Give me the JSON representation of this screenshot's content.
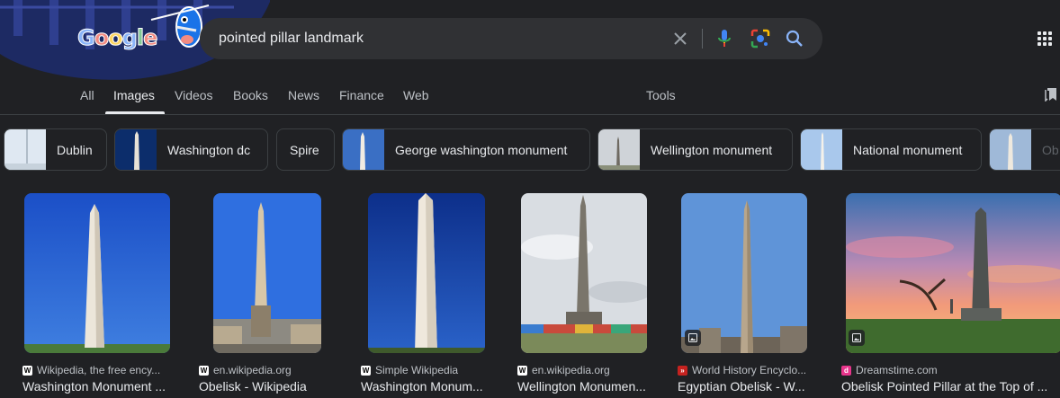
{
  "search": {
    "query": "pointed pillar landmark"
  },
  "logo": {
    "letters": [
      "G",
      "o",
      "o",
      "g",
      "l",
      "e"
    ]
  },
  "tabs": [
    {
      "label": "All"
    },
    {
      "label": "Images"
    },
    {
      "label": "Videos"
    },
    {
      "label": "Books"
    },
    {
      "label": "News"
    },
    {
      "label": "Finance"
    },
    {
      "label": "Web"
    }
  ],
  "tools": {
    "label": "Tools"
  },
  "chips": [
    {
      "label": "Dublin"
    },
    {
      "label": "Washington dc"
    },
    {
      "label": "Spire"
    },
    {
      "label": "George washington monument"
    },
    {
      "label": "Wellington monument"
    },
    {
      "label": "National monument"
    },
    {
      "label": "Ob"
    }
  ],
  "results": [
    {
      "source": "Wikipedia, the free ency...",
      "title": "Washington Monument ...",
      "favicon": "W"
    },
    {
      "source": "en.wikipedia.org",
      "title": "Obelisk - Wikipedia",
      "favicon": "W"
    },
    {
      "source": "Simple Wikipedia",
      "title": "Washington Monum...",
      "favicon": "W"
    },
    {
      "source": "en.wikipedia.org",
      "title": "Wellington Monumen...",
      "favicon": "W"
    },
    {
      "source": "World History Encyclo...",
      "title": "Egyptian Obelisk - W...",
      "favicon": "»"
    },
    {
      "source": "Dreamstime.com",
      "title": "Obelisk Pointed Pillar at the Top of ...",
      "favicon": "d"
    }
  ],
  "colors": {
    "background": "#202124",
    "searchbox": "#303134",
    "text": "#e8eaed",
    "muted": "#bdc1c6",
    "accent": "#8ab4f8"
  }
}
